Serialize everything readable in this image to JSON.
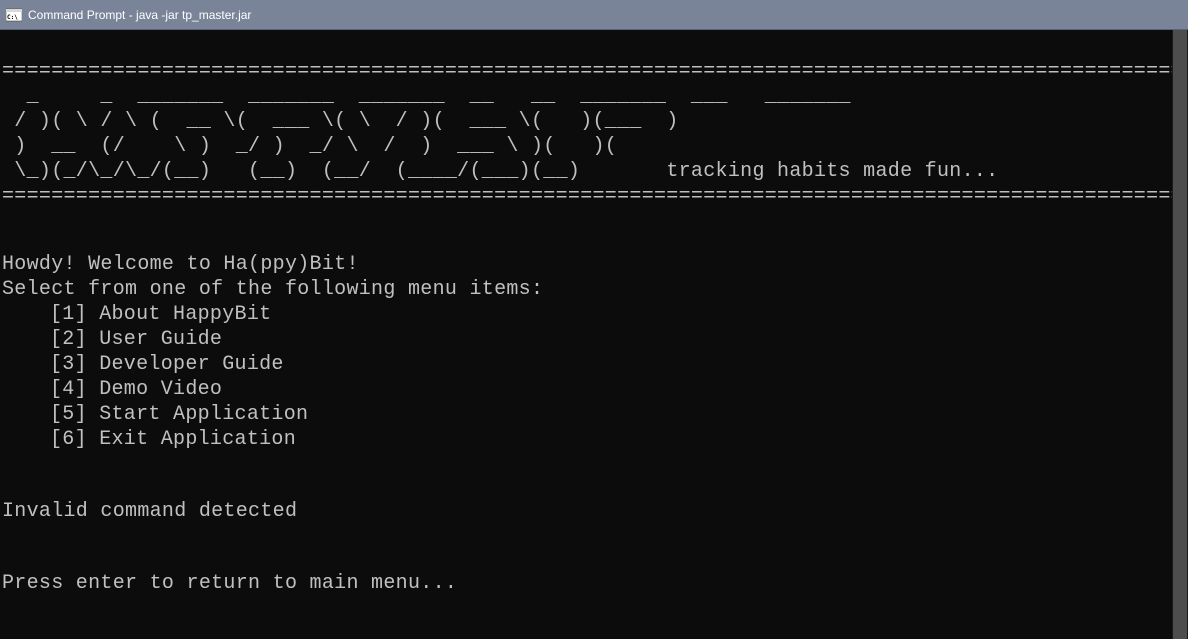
{
  "titlebar": {
    "title": "Command Prompt - java  -jar tp_master.jar"
  },
  "banner": {
    "divider_top": "================================================================================================",
    "ascii_lines": [
      "  _     _  _______  _______  _______  __   __  _______  ___   _______ ",
      " / )( \\ / \\ (  __ \\(  ___ \\( \\  / )(  ___ \\(   )(___  )",
      " )  __  (/    \\ )  _/ )  _/ \\  /  )  ___ \\ )(   )(",
      " \\_)(_/\\_/\\_/(__)   (__)  (__/  (____/(___)(__)"
    ],
    "tagline": "tracking habits made fun...",
    "divider_bot": "================================================================================================"
  },
  "welcome": {
    "greeting": "Howdy! Welcome to Ha(ppy)Bit!",
    "instruction": "Select from one of the following menu items:"
  },
  "menu": {
    "items": [
      "[1] About HappyBit",
      "[2] User Guide",
      "[3] Developer Guide",
      "[4] Demo Video",
      "[5] Start Application",
      "[6] Exit Application"
    ]
  },
  "error": "Invalid command detected",
  "prompt": "Press enter to return to main menu..."
}
